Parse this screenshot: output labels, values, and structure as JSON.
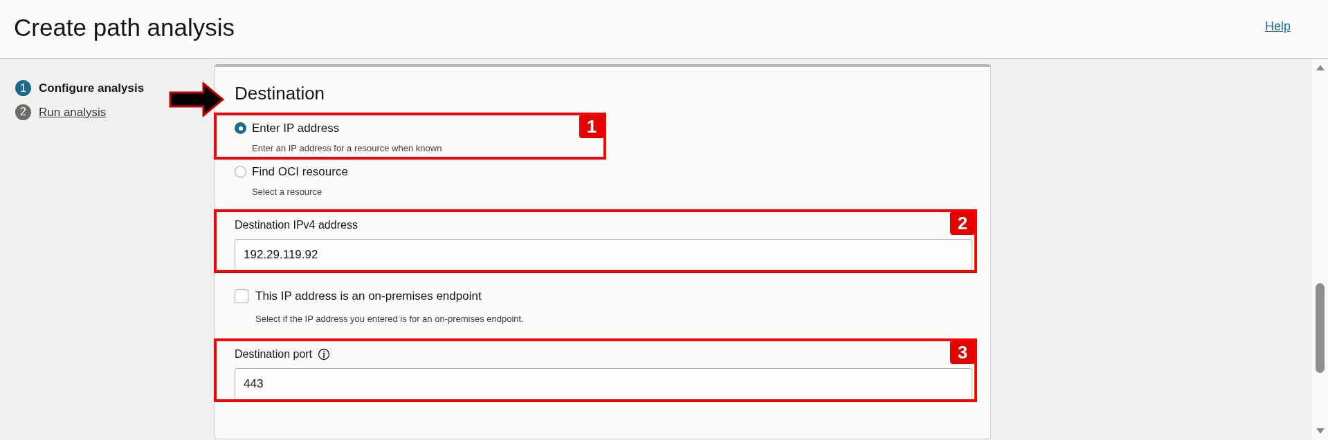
{
  "header": {
    "title": "Create path analysis",
    "help_link": "Help"
  },
  "steps": [
    {
      "number": "1",
      "label": "Configure analysis",
      "selected": true
    },
    {
      "number": "2",
      "label": "Run analysis",
      "selected": false
    }
  ],
  "section": {
    "title": "Destination",
    "radio_options": [
      {
        "label": "Enter IP address",
        "description": "Enter an IP address for a resource when known",
        "selected": true
      },
      {
        "label": "Find OCI resource",
        "description": "Select a resource",
        "selected": false
      }
    ],
    "ip_field": {
      "label": "Destination IPv4 address",
      "value": "192.29.119.92"
    },
    "on_premises": {
      "label": "This IP address is an on-premises endpoint",
      "description": "Select if the IP address you entered is for an on-premises endpoint.",
      "checked": false
    },
    "port_field": {
      "label": "Destination port",
      "value": "443"
    }
  },
  "annotations": [
    {
      "number": "1"
    },
    {
      "number": "2"
    },
    {
      "number": "3"
    }
  ]
}
